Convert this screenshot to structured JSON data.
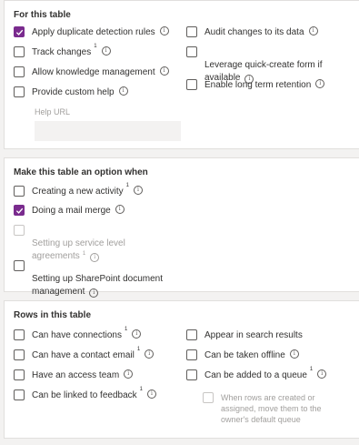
{
  "sections": {
    "table": {
      "title": "For this table",
      "items": {
        "duplicate": {
          "label": "Apply duplicate detection rules",
          "checked": true
        },
        "track": {
          "label": "Track changes",
          "sup": "1"
        },
        "knowledge": {
          "label": "Allow knowledge management"
        },
        "help": {
          "label": "Provide custom help"
        },
        "audit": {
          "label": "Audit changes to its data"
        },
        "quickcreate": {
          "label": "Leverage quick-create form if\navailable"
        },
        "retention": {
          "label": "Enable long term retention"
        }
      },
      "help_url": {
        "label": "Help URL",
        "value": ""
      }
    },
    "option": {
      "title": "Make this table an option when",
      "items": {
        "activity": {
          "label": "Creating a new activity",
          "sup": "1"
        },
        "mailmerge": {
          "label": "Doing a mail merge",
          "checked": true
        },
        "sla": {
          "label": "Setting up service level\nagreements",
          "sup": "1",
          "disabled": true
        },
        "sharepoint": {
          "label": "Setting up SharePoint document\nmanagement"
        }
      }
    },
    "rows": {
      "title": "Rows in this table",
      "items": {
        "connections": {
          "label": "Can have connections",
          "sup": "1"
        },
        "email": {
          "label": "Can have a contact email",
          "sup": "1"
        },
        "access": {
          "label": "Have an access team"
        },
        "feedback": {
          "label": "Can be linked to feedback",
          "sup": "1"
        },
        "search": {
          "label": "Appear in search results"
        },
        "offline": {
          "label": "Can be taken offline"
        },
        "queue": {
          "label": "Can be added to a queue",
          "sup": "1"
        },
        "queue_move": {
          "label": "When rows are created or\nassigned, move them to the\nowner's default queue",
          "disabled": true
        }
      }
    }
  },
  "icons": {
    "info": "info-icon",
    "check": "checkmark-icon"
  },
  "colors": {
    "accent": "#7a2b8e",
    "disabled_text": "#a19f9d"
  }
}
